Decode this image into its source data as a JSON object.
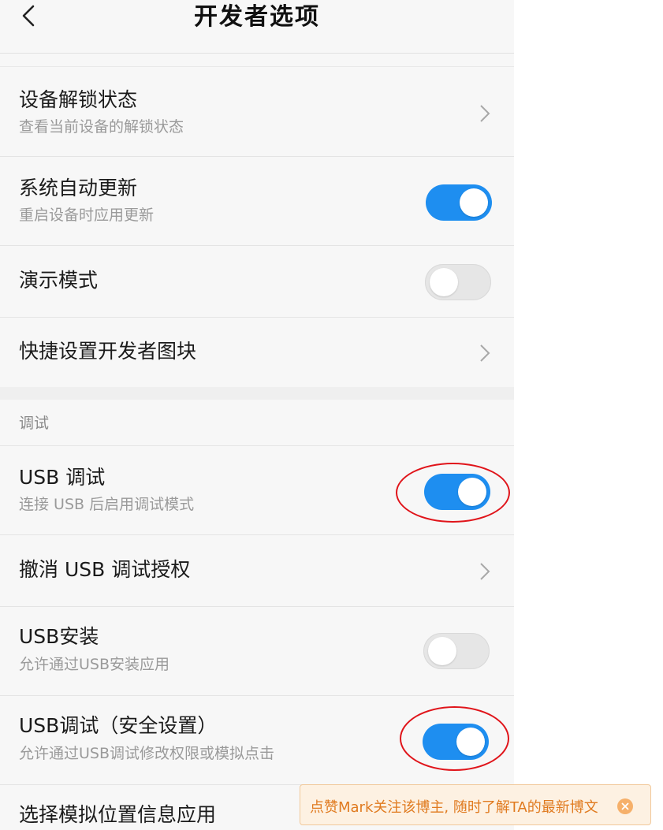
{
  "header": {
    "title": "开发者选项"
  },
  "rows": [
    {
      "title": "设备解锁状态",
      "subtitle": "查看当前设备的解锁状态",
      "control": "chevron"
    },
    {
      "title": "系统自动更新",
      "subtitle": "重启设备时应用更新",
      "control": "toggle",
      "on": true
    },
    {
      "title": "演示模式",
      "control": "toggle",
      "on": false
    },
    {
      "title": "快捷设置开发者图块",
      "control": "chevron"
    }
  ],
  "debug_section": {
    "header": "调试",
    "rows": [
      {
        "title": "USB 调试",
        "subtitle": "连接 USB 后启用调试模式",
        "control": "toggle",
        "on": true
      },
      {
        "title": "撤消 USB 调试授权",
        "control": "chevron"
      },
      {
        "title": "USB安装",
        "subtitle": "允许通过USB安装应用",
        "control": "toggle",
        "on": false
      },
      {
        "title": "USB调试（安全设置）",
        "subtitle": "允许通过USB调试修改权限或模拟点击",
        "control": "toggle",
        "on": true
      },
      {
        "title": "选择模拟位置信息应用",
        "control": "chevron"
      }
    ]
  },
  "toast": {
    "text": "点赞Mark关注该博主, 随时了解TA的最新博文"
  },
  "colors": {
    "toggle_on": "#1e8ef0",
    "annotation": "#e0141a",
    "toast_text": "#e07a1f"
  }
}
